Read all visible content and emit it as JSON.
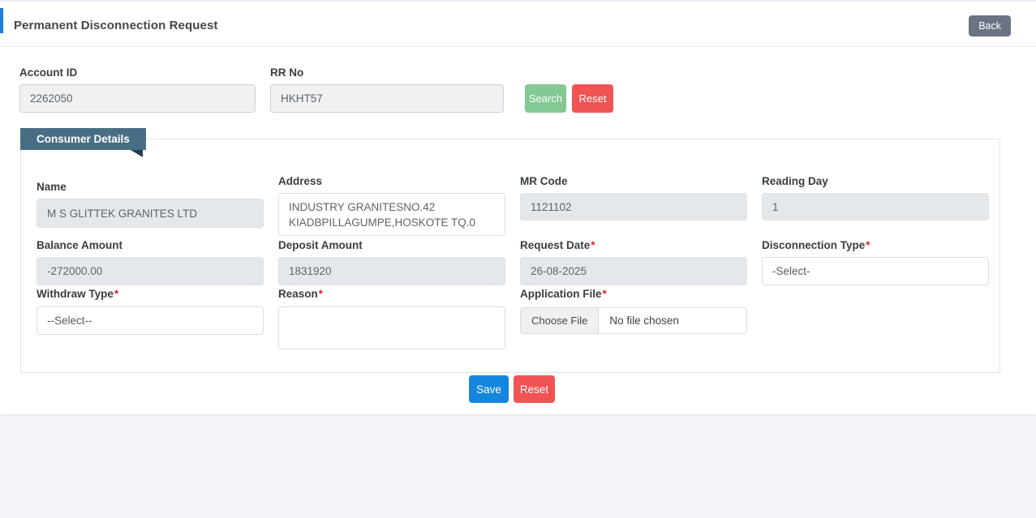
{
  "page": {
    "title": "Permanent Disconnection Request",
    "back_label": "Back"
  },
  "search_bar": {
    "account_id": {
      "label": "Account ID",
      "value": "2262050"
    },
    "rr_no": {
      "label": "RR No",
      "value": "HKHT57"
    },
    "search_label": "Search",
    "reset_label": "Reset"
  },
  "consumer_details": {
    "tab_label": "Consumer Details",
    "name": {
      "label": "Name",
      "value": "M S GLITTEK GRANITES LTD"
    },
    "address": {
      "label": "Address",
      "value": "INDUSTRY GRANITESNO.42 KIADBPILLAGUMPE,HOSKOTE TQ.0"
    },
    "mr_code": {
      "label": "MR Code",
      "value": "1121102"
    },
    "reading_day": {
      "label": "Reading Day",
      "value": "1"
    },
    "balance_amount": {
      "label": "Balance Amount",
      "value": "-272000.00"
    },
    "deposit_amount": {
      "label": "Deposit Amount",
      "value": "1831920"
    },
    "request_date": {
      "label": "Request Date",
      "required": "*",
      "value": "26-08-2025"
    },
    "disconnection_type": {
      "label": "Disconnection Type",
      "required": "*",
      "value": "-Select-"
    },
    "withdraw_type": {
      "label": "Withdraw Type",
      "required": "*",
      "value": "--Select--"
    },
    "reason": {
      "label": "Reason",
      "required": "*",
      "value": ""
    },
    "application_file": {
      "label": "Application File",
      "required": "*",
      "button_label": "Choose File",
      "status": "No file chosen"
    }
  },
  "actions": {
    "save_label": "Save",
    "reset_label": "Reset"
  },
  "colors": {
    "accent_blue": "#1b7fd6",
    "tab_blue": "#476e84",
    "tab_notch": "#1f3f50",
    "search_green": "#84c893",
    "reset_red": "#f15353",
    "save_blue": "#1486dd",
    "back_gray": "#6b7383",
    "disabled_input_bg": "#e5e8eb",
    "page_bg": "#f4f5f9"
  }
}
